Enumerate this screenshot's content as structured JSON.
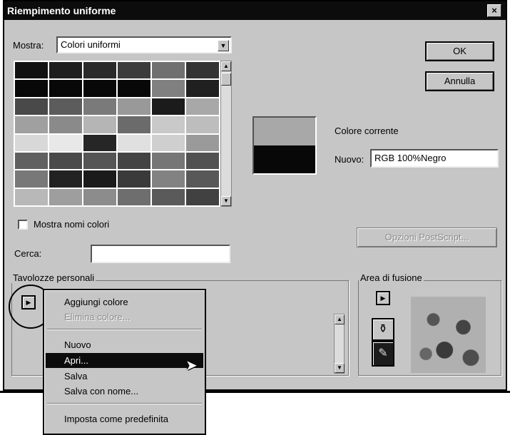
{
  "window": {
    "title": "Riempimento uniforme",
    "close_label": "×"
  },
  "mostra": {
    "label": "Mostra:",
    "value": "Colori uniformi"
  },
  "buttons": {
    "ok": "OK",
    "annulla": "Annulla",
    "postscript": "Opzioni PostScript..."
  },
  "palette": {
    "rows": [
      [
        "#111111",
        "#1e1e1e",
        "#2a2a2a",
        "#3c3c3c",
        "#707070",
        "#333333"
      ],
      [
        "#080808",
        "#080808",
        "#080808",
        "#080808",
        "#808080",
        "#202020"
      ],
      [
        "#494949",
        "#5c5c5c",
        "#7a7a7a",
        "#999999",
        "#1b1b1b",
        "#a8a8a8"
      ],
      [
        "#a0a0a0",
        "#8a8a8a",
        "#b5b5b5",
        "#6b6b6b",
        "#c9c9c9",
        "#bdbdbd"
      ],
      [
        "#d8d8d8",
        "#e8e8e8",
        "#262626",
        "#e0e0e0",
        "#cfcfcf",
        "#9a9a9a"
      ],
      [
        "#606060",
        "#4a4a4a",
        "#555555",
        "#444444",
        "#767676",
        "#515151"
      ],
      [
        "#787878",
        "#222222",
        "#1a1a1a",
        "#3a3a3a",
        "#828282",
        "#585858"
      ],
      [
        "#b8b8b8",
        "#9e9e9e",
        "#8c8c8c",
        "#6e6e6e",
        "#5a5a5a",
        "#414141"
      ]
    ]
  },
  "colors": {
    "old": "#a8a8a8",
    "new": "#080808"
  },
  "corrente_label": "Colore corrente",
  "nuovo": {
    "label": "Nuovo:",
    "value": "RGB 100%Negro"
  },
  "mostra_nomi_label": "Mostra nomi colori",
  "cerca_label": "Cerca:",
  "tavolozze_label": "Tavolozze personali",
  "area_label": "Area di fusione",
  "menu": {
    "items": [
      {
        "label": "Aggiungi colore"
      },
      {
        "label": "Elimina colore..."
      },
      {
        "label": "Nuovo"
      },
      {
        "label": "Apri..."
      },
      {
        "label": "Salva"
      },
      {
        "label": "Salva con nome..."
      },
      {
        "label": "Imposta come predefinita"
      }
    ]
  },
  "icons": {
    "flyout": "triangle-right-icon",
    "dropper": "eyedropper-icon",
    "mixer": "mixer-icon",
    "cursor": "pointer-icon"
  }
}
